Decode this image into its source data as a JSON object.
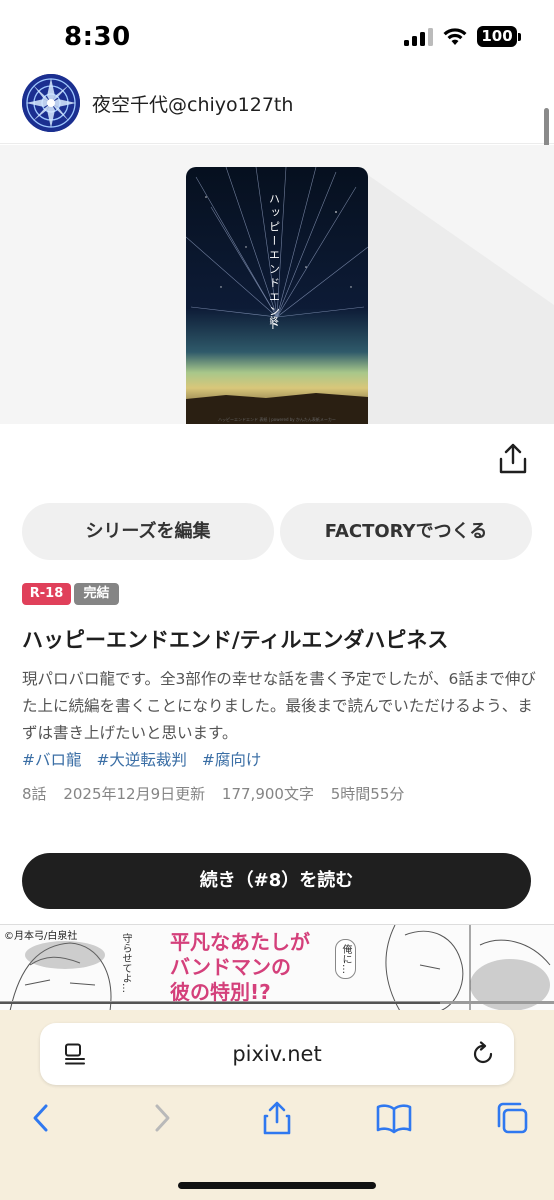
{
  "status_bar": {
    "time": "8:30",
    "battery": "100"
  },
  "author": {
    "name": "夜空千代@chiyo127th"
  },
  "cover": {
    "title_vertical": "ハッピーエンドエンド",
    "title_end": "終",
    "caption": "ハッピーエンドエンド 表紙 | powered by かんたん表紙メーカー"
  },
  "actions": {
    "edit_series": "シリーズを編集",
    "factory": "FACTORYでつくる"
  },
  "badges": {
    "rating": "R-18",
    "status": "完結"
  },
  "series": {
    "title": "ハッピーエンドエンド/ティルエンダハピネス",
    "description": "現パロバロ龍です。全3部作の幸せな話を書く予定でしたが、6話まで伸びた上に続編を書くことになりました。最後まで読んでいただけるよう、まずは書き上げたいと思います。",
    "tags": [
      "#バロ龍",
      "#大逆転裁判",
      "#腐向け"
    ],
    "meta": {
      "episodes": "8話",
      "updated": "2025年12月9日更新",
      "characters": "177,900文字",
      "reading_time": "5時間55分"
    }
  },
  "read_button": "続き（#8）を読む",
  "ad": {
    "copyright": "©月本弓/白泉社",
    "headline_line1": "平凡なあたしが",
    "headline_line2": "バンドマンの",
    "headline_line3": "彼の特別!?",
    "bubble_left": "守らせてよ…",
    "bubble_right": "俺に…"
  },
  "browser": {
    "url": "pixiv.net"
  },
  "colors": {
    "badge_r18": "#e0405a",
    "badge_complete": "#858585",
    "tag_link": "#3a6ea5",
    "read_button_bg": "#1f1f1f",
    "safari_bar_bg": "#f6eedc",
    "ad_headline": "#d4407b"
  },
  "icons": {
    "share": "share-icon",
    "page_menu": "page-menu-icon",
    "reload": "reload-icon",
    "back": "back-chevron-icon",
    "forward": "forward-chevron-icon",
    "safari_share": "share-icon",
    "bookmarks": "book-icon",
    "tabs": "tabs-icon"
  }
}
